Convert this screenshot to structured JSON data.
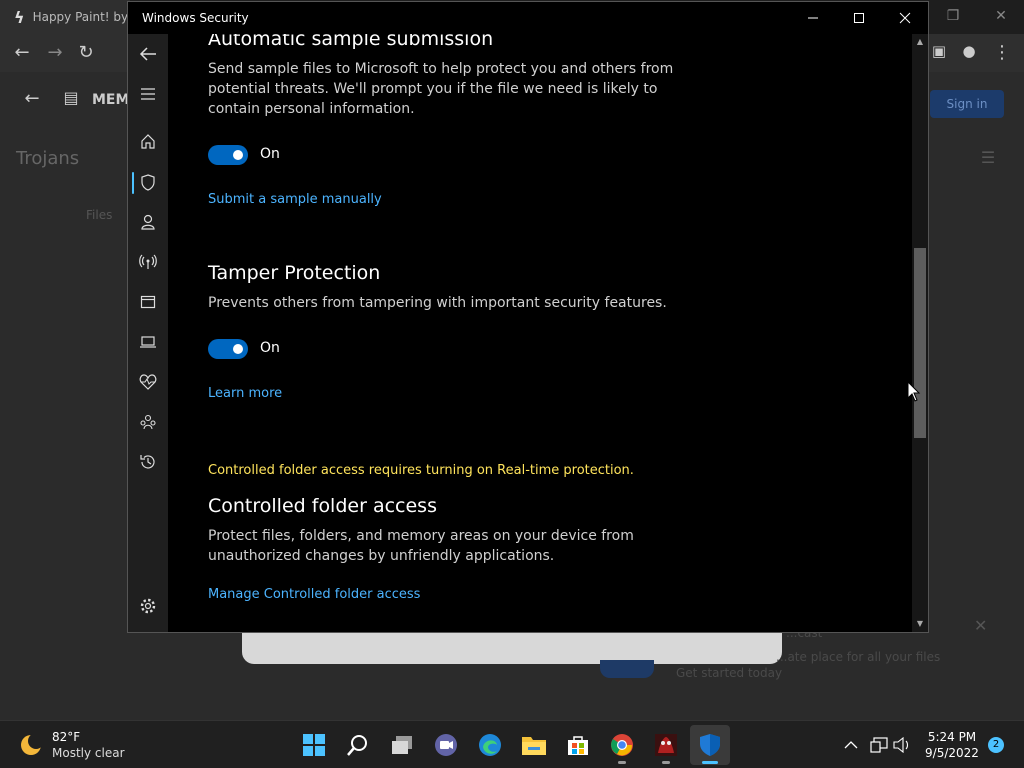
{
  "background_browser": {
    "tab_title": "Happy Paint! by",
    "app_title": "MEMZ",
    "page_heading": "Trojans",
    "files_label": "Files",
    "side_text_1": "...cast",
    "side_text_2": "...ate place for all your files",
    "side_text_3": "Get started today",
    "signin_label": "Sign in"
  },
  "window": {
    "title": "Windows Security",
    "minimize_label": "–",
    "maximize_label": "□",
    "close_label": "✕"
  },
  "nav": {
    "icons": [
      "back-arrow-icon",
      "hamburger-icon",
      "home-icon",
      "shield-icon",
      "account-icon",
      "network-icon",
      "app-browser-icon",
      "device-security-icon",
      "health-icon",
      "family-icon",
      "history-icon",
      "settings-icon"
    ],
    "accent": "#4cc2ff"
  },
  "sections": {
    "sample": {
      "heading": "Automatic sample submission",
      "description": "Send sample files to Microsoft to help protect you and others from potential threats. We'll prompt you if the file we need is likely to contain personal information.",
      "toggle_state": "On",
      "link": "Submit a sample manually"
    },
    "tamper": {
      "heading": "Tamper Protection",
      "description": "Prevents others from tampering with important security features.",
      "toggle_state": "On",
      "link": "Learn more"
    },
    "cfa": {
      "warning": "Controlled folder access requires turning on Real-time protection.",
      "heading": "Controlled folder access",
      "description": "Protect files, folders, and memory areas on your device from unauthorized changes by unfriendly applications.",
      "link": "Manage Controlled folder access"
    }
  },
  "taskbar": {
    "weather_temp": "82°F",
    "weather_desc": "Mostly clear",
    "apps": [
      "start-icon",
      "search-icon",
      "task-view-icon",
      "teams-chat-icon",
      "edge-icon",
      "file-explorer-icon",
      "store-icon",
      "chrome-icon",
      "happy-paint-icon",
      "windows-security-icon"
    ],
    "time": "5:24 PM",
    "date": "9/5/2022",
    "notification_count": "2"
  },
  "colors": {
    "toggle_on": "#0067c0",
    "link": "#4cb4ff",
    "warning": "#ffe45c"
  }
}
